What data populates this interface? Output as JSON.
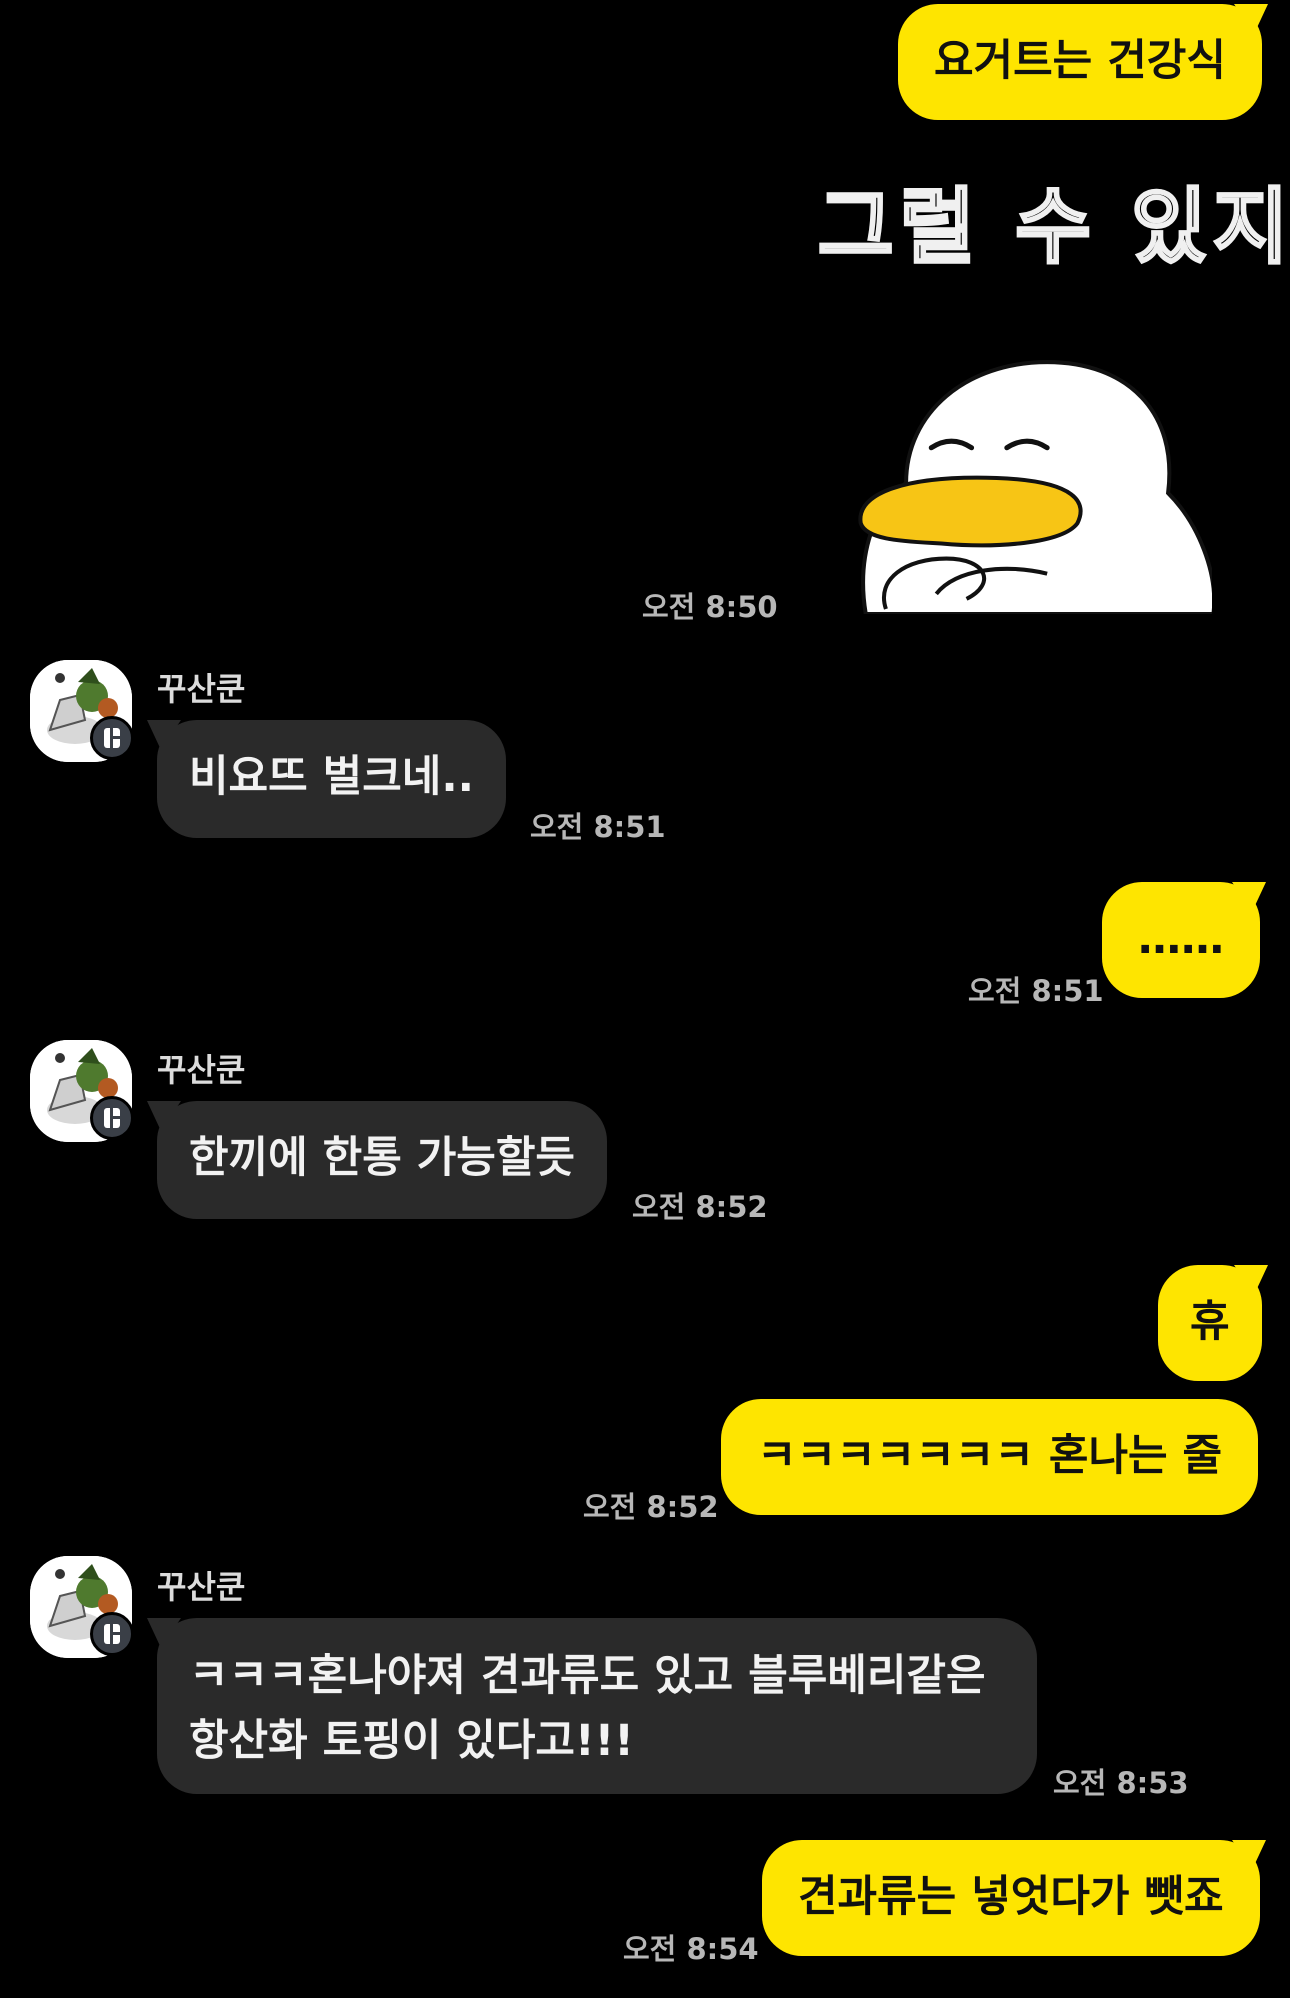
{
  "chat": {
    "sender_name": "꾸산쿤",
    "messages": [
      {
        "from": "me",
        "text": "요거트는 건강식"
      },
      {
        "from": "me",
        "type": "sticker",
        "text": "그럴 수 있지",
        "time": "오전 8:50"
      },
      {
        "from": "other",
        "text": "비요뜨 벌크네..",
        "time": "오전 8:51"
      },
      {
        "from": "me",
        "text": "……",
        "time": "오전 8:51"
      },
      {
        "from": "other",
        "text": "한끼에 한통 가능할듯",
        "time": "오전 8:52"
      },
      {
        "from": "me",
        "text": "휴"
      },
      {
        "from": "me",
        "text": "ㅋㅋㅋㅋㅋㅋㅋ 혼나는 줄",
        "time": "오전 8:52"
      },
      {
        "from": "other",
        "text_line1": "ㅋㅋㅋ혼나야져 견과류도 있고 블루베리같은",
        "text_line2": "항산화 토핑이 있다고!!!",
        "time": "오전 8:53"
      },
      {
        "from": "me",
        "text": "견과류는 넣엇다가 뺏죠",
        "time": "오전 8:54"
      }
    ]
  },
  "colors": {
    "background": "#000000",
    "my_bubble": "#FEE500",
    "other_bubble": "#2a2a2a",
    "timestamp": "#b7b7b7"
  },
  "icons": {
    "avatar": "knight-on-horse-avatar",
    "badge": "channel-badge-icon",
    "sticker": "white-duck-sticker"
  }
}
